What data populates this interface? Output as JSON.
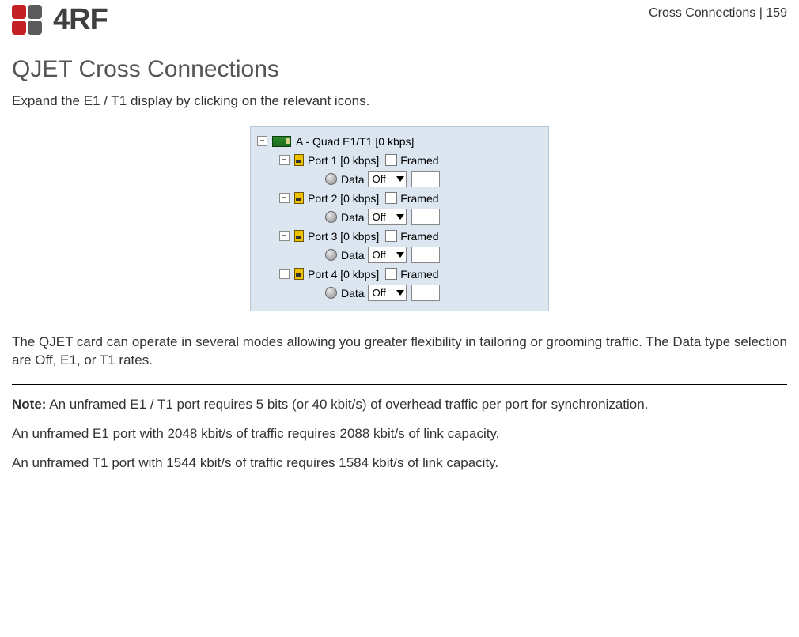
{
  "header": {
    "logo_text": "4RF",
    "right": "Cross Connections  |  159"
  },
  "title": "QJET Cross Connections",
  "intro": "Expand the E1 / T1 display by clicking on the relevant icons.",
  "tree": {
    "root_label": "A - Quad E1/T1 [0 kbps]",
    "framed_label": "Framed",
    "data_label": "Data",
    "select_value": "Off",
    "ports": [
      {
        "label": "Port 1 [0 kbps]"
      },
      {
        "label": "Port 2 [0 kbps]"
      },
      {
        "label": "Port 3 [0 kbps]"
      },
      {
        "label": "Port 4 [0 kbps]"
      }
    ]
  },
  "para2": "The QJET card can operate in several modes allowing you greater flexibility in tailoring or grooming traffic. The Data type selection are Off, E1, or T1 rates.",
  "note": {
    "label": "Note:",
    "p1": " An unframed E1 / T1 port requires 5 bits (or 40 kbit/s) of overhead traffic per port for synchronization.",
    "p2": "An unframed E1 port with 2048 kbit/s of traffic requires 2088 kbit/s of link capacity.",
    "p3": "An unframed T1 port with 1544 kbit/s of traffic requires 1584 kbit/s of link capacity."
  }
}
